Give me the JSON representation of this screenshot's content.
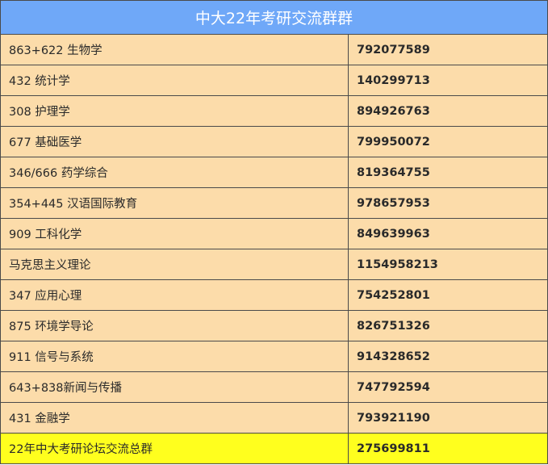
{
  "header": {
    "title": "中大22年考研交流群群"
  },
  "rows": [
    {
      "name": "863+622 生物学",
      "number": "792077589"
    },
    {
      "name": "432 统计学",
      "number": "140299713"
    },
    {
      "name": "308 护理学",
      "number": "894926763"
    },
    {
      "name": "677 基础医学",
      "number": "799950072"
    },
    {
      "name": "346/666 药学综合",
      "number": "819364755"
    },
    {
      "name": "354+445 汉语国际教育",
      "number": "978657953"
    },
    {
      "name": "909 工科化学",
      "number": "849639963"
    },
    {
      "name": "马克思主义理论",
      "number": "1154958213"
    },
    {
      "name": "347 应用心理",
      "number": "754252801"
    },
    {
      "name": "875 环境学导论",
      "number": "826751326"
    },
    {
      "name": "911 信号与系统",
      "number": "914328652"
    },
    {
      "name": "643+838新闻与传播",
      "number": "747792594"
    },
    {
      "name": "431 金融学",
      "number": "793921190"
    },
    {
      "name": "22年中大考研论坛交流总群",
      "number": "275699811"
    }
  ],
  "colors": {
    "header_bg": "#6fa8f8",
    "row_bg": "#fcdcaa",
    "highlight_bg": "#ffff1e"
  }
}
